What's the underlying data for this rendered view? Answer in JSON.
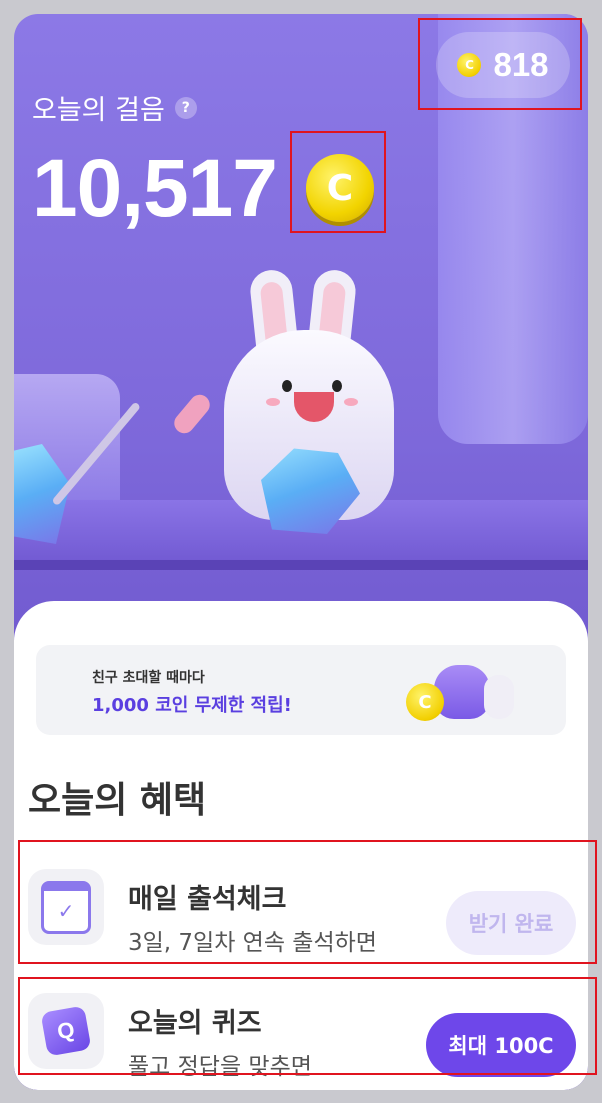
{
  "header": {
    "coin_balance": "818",
    "steps_label": "오늘의 걸음",
    "help_symbol": "?",
    "steps_value": "10,517",
    "coin_symbol": "C"
  },
  "banner": {
    "subtitle": "친구 초대할 때마다",
    "title": "1,000 코인 무제한 적립!",
    "coin_symbol": "C"
  },
  "benefits": {
    "section_title": "오늘의 혜택",
    "items": [
      {
        "title": "매일 출석체크",
        "description": "3일, 7일차 연속 출석하면",
        "action_label": "받기 완료",
        "icon": "calendar-check-icon",
        "icon_glyph": "✓"
      },
      {
        "title": "오늘의 퀴즈",
        "description": "풀고 정답을 맞추면",
        "action_label": "최대 100C",
        "icon": "quiz-icon",
        "icon_glyph": "Q"
      }
    ]
  },
  "colors": {
    "accent": "#6e47ea",
    "coin": "#f2cf00",
    "highlight": "#e0141f"
  }
}
